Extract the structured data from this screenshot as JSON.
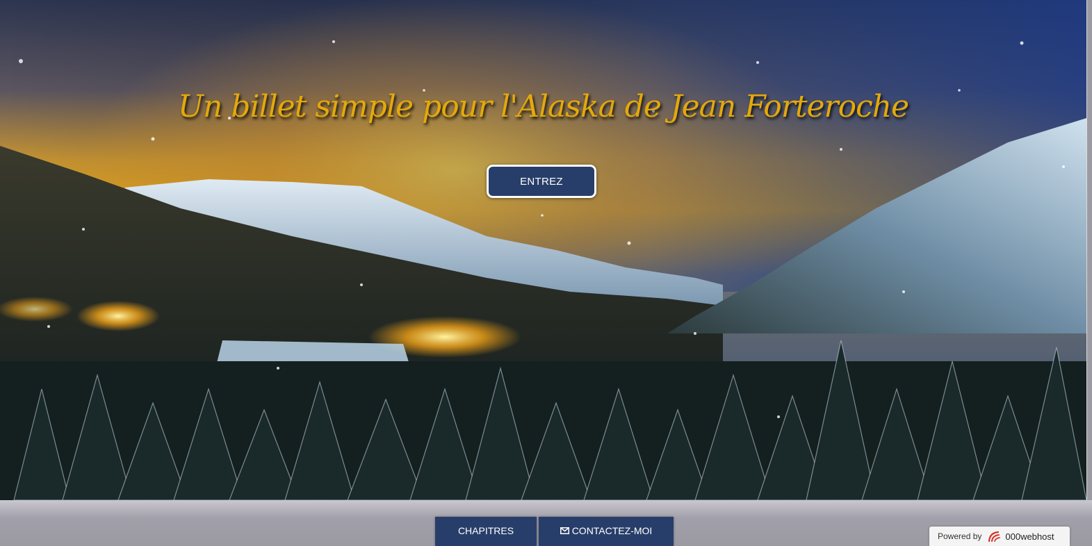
{
  "hero": {
    "title": "Un billet simple pour l'Alaska de Jean Forteroche",
    "enter_label": "ENTREZ"
  },
  "nav": {
    "items": [
      {
        "label": "CHAPITRES",
        "icon": null
      },
      {
        "label": "CONTACTEZ-MOI",
        "icon": "envelope-icon"
      }
    ]
  },
  "badge": {
    "powered_label": "Powered by",
    "brand": "000webhost",
    "icon": "000webhost-logo-icon"
  },
  "colors": {
    "title": "#e3a90c",
    "button_bg": "#283e6a",
    "footer_bg": "#9b9aa3"
  }
}
